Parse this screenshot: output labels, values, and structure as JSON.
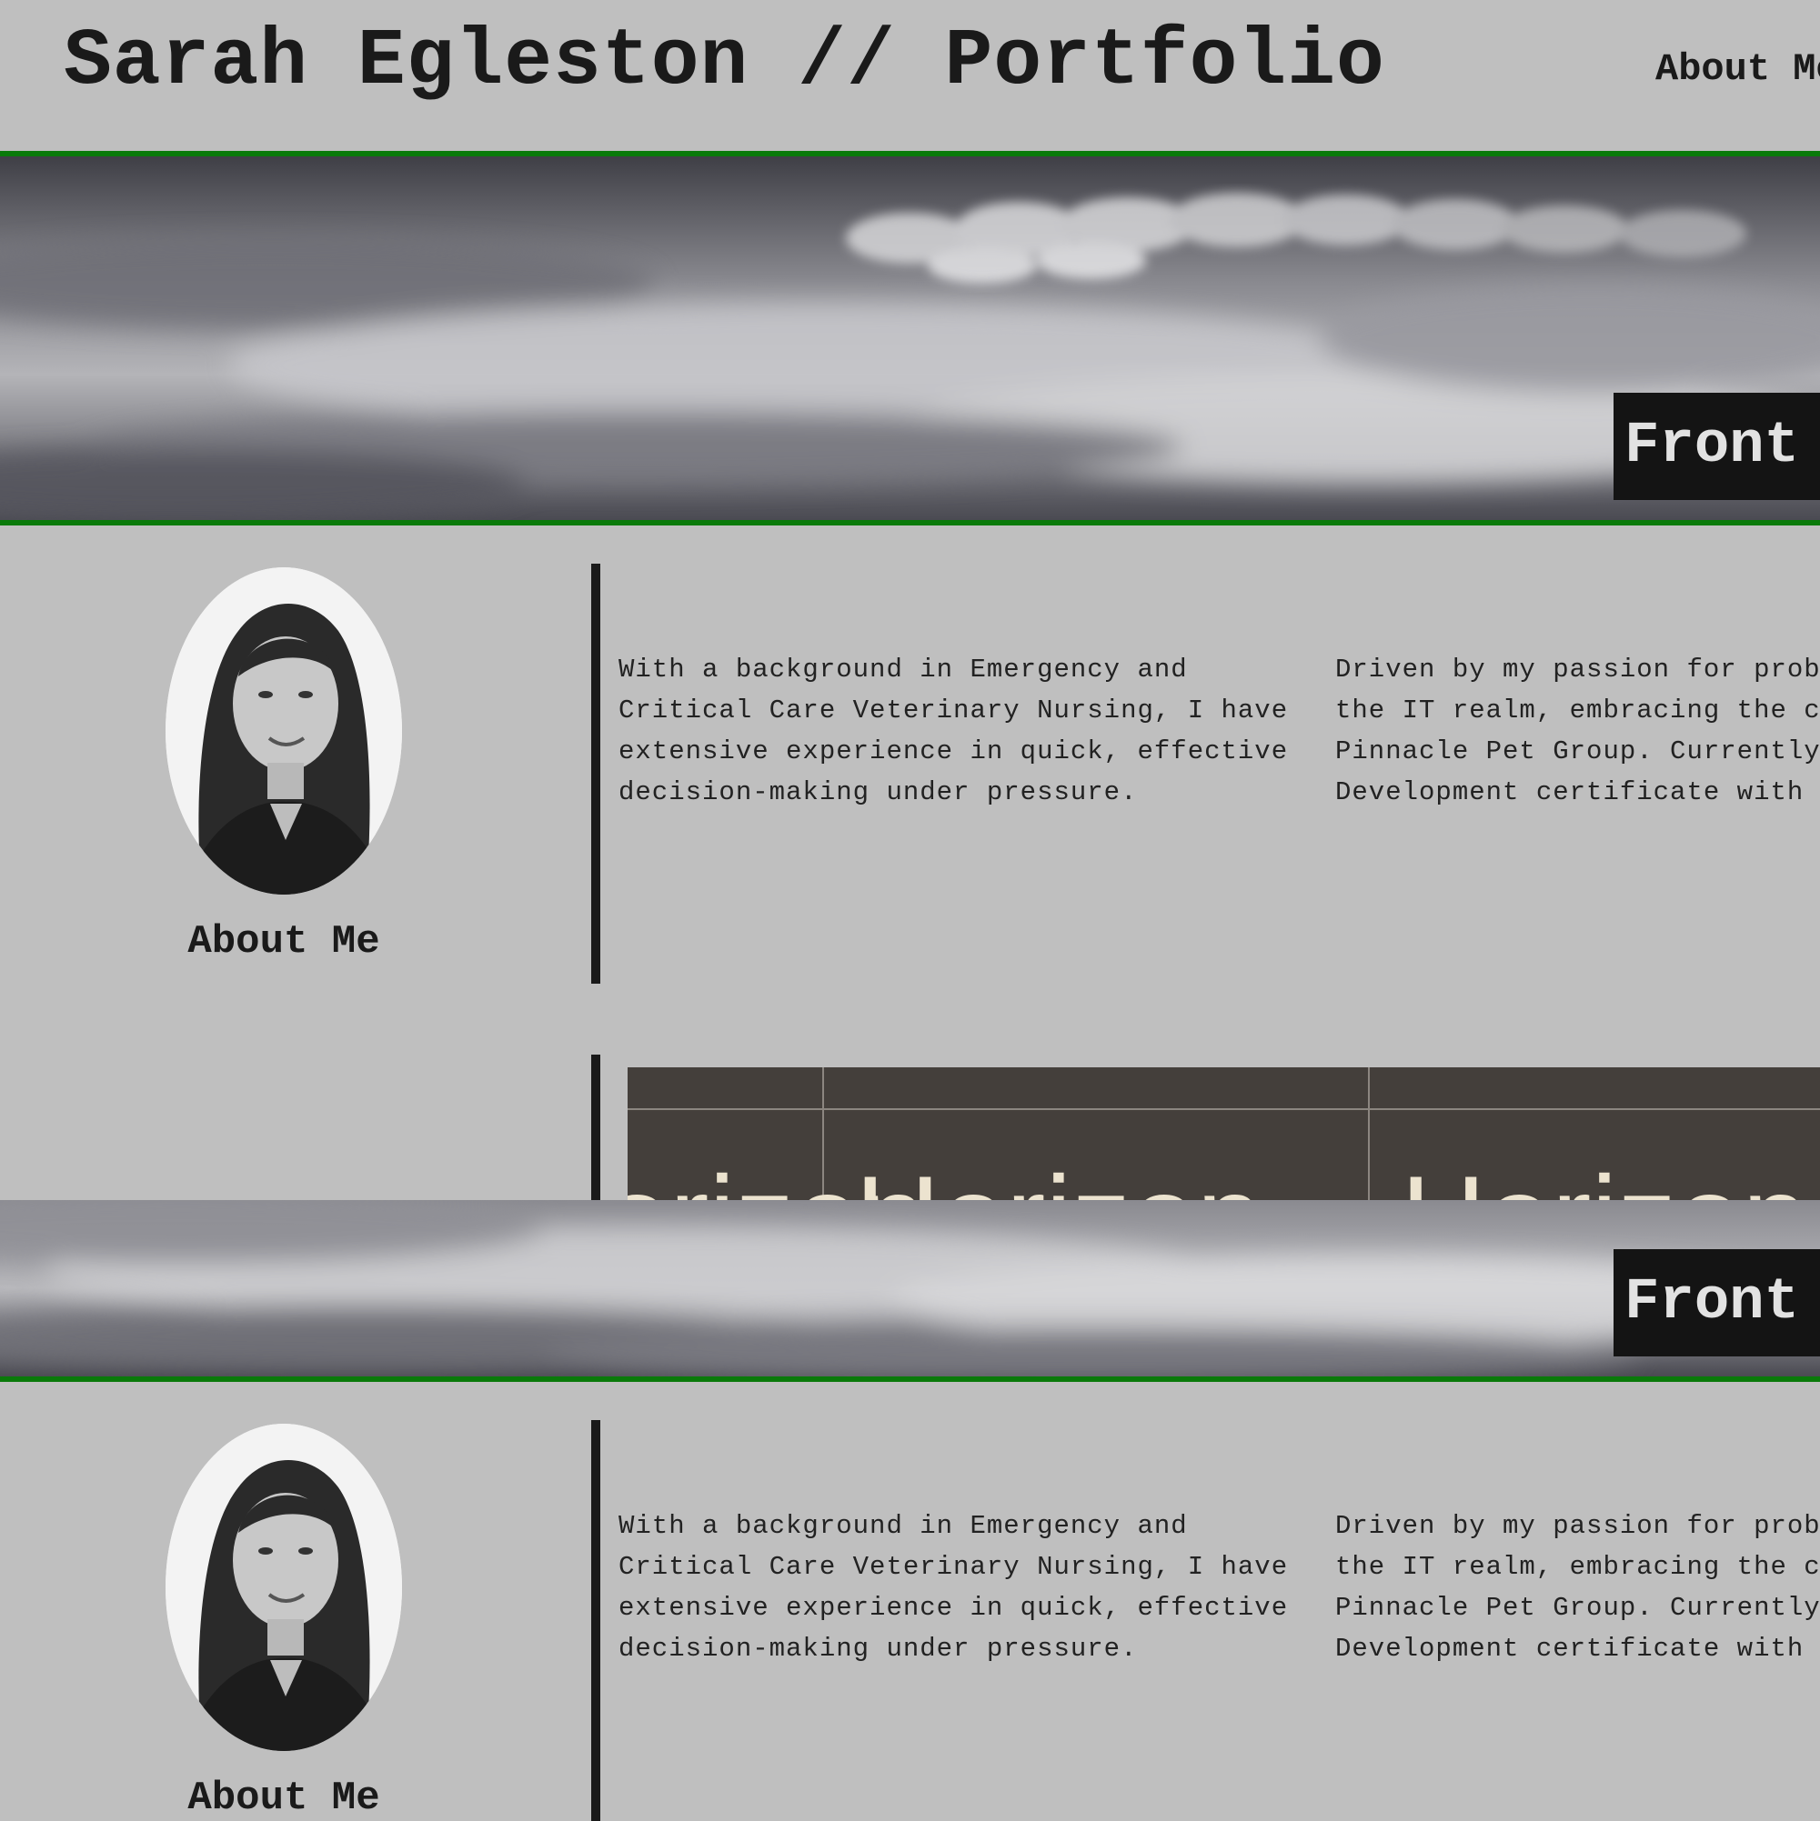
{
  "header": {
    "site_title": "Sarah Egleston // Portfolio",
    "nav": [
      "About Me"
    ]
  },
  "hero": {
    "badge_label": "Front"
  },
  "about": {
    "heading": "About Me",
    "paragraph_1": "With a background in Emergency and Critical Care Veterinary Nursing, I have extensive experience in quick, effective decision-making under pressure.",
    "paragraph_2_lines": [
      "Driven by my passion for probl",
      "the IT realm, embracing the ch",
      "Pinnacle Pet Group. Currently,",
      "Development certificate with e"
    ]
  },
  "project_preview": {
    "word": "Horizon"
  },
  "colors": {
    "background": "#bfbfbf",
    "accent_rule": "#0a7a0a",
    "text": "#1a1a1a",
    "badge_bg": "#141414",
    "project_bg": "#443f3b",
    "project_text": "#ece3cf"
  }
}
